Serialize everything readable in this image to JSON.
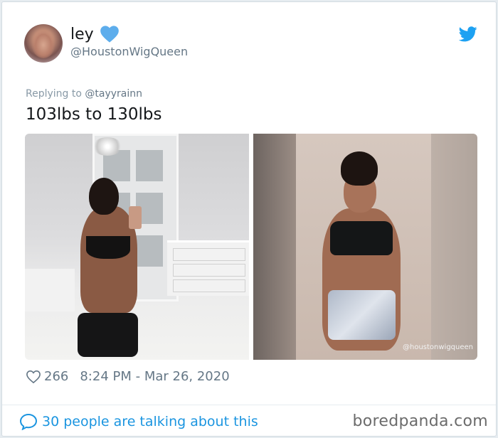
{
  "tweet": {
    "author": {
      "display_name": "ley",
      "emoji": "blue-heart-icon",
      "handle": "@HoustonWigQueen"
    },
    "replying_prefix": "Replying to ",
    "replying_to": "@tayyrainn",
    "text": "103lbs to 130lbs",
    "photos": [
      {
        "watermark": ""
      },
      {
        "watermark": "@houstonwigqueen"
      }
    ],
    "likes": "266",
    "timestamp": "8:24 PM - Mar 26, 2020",
    "conversation": "30 people are talking about this"
  },
  "brand": "boredpanda.com",
  "colors": {
    "twitter_blue": "#1da1f2",
    "link_blue": "#1b95e0",
    "muted": "#657786",
    "text": "#14171a"
  }
}
